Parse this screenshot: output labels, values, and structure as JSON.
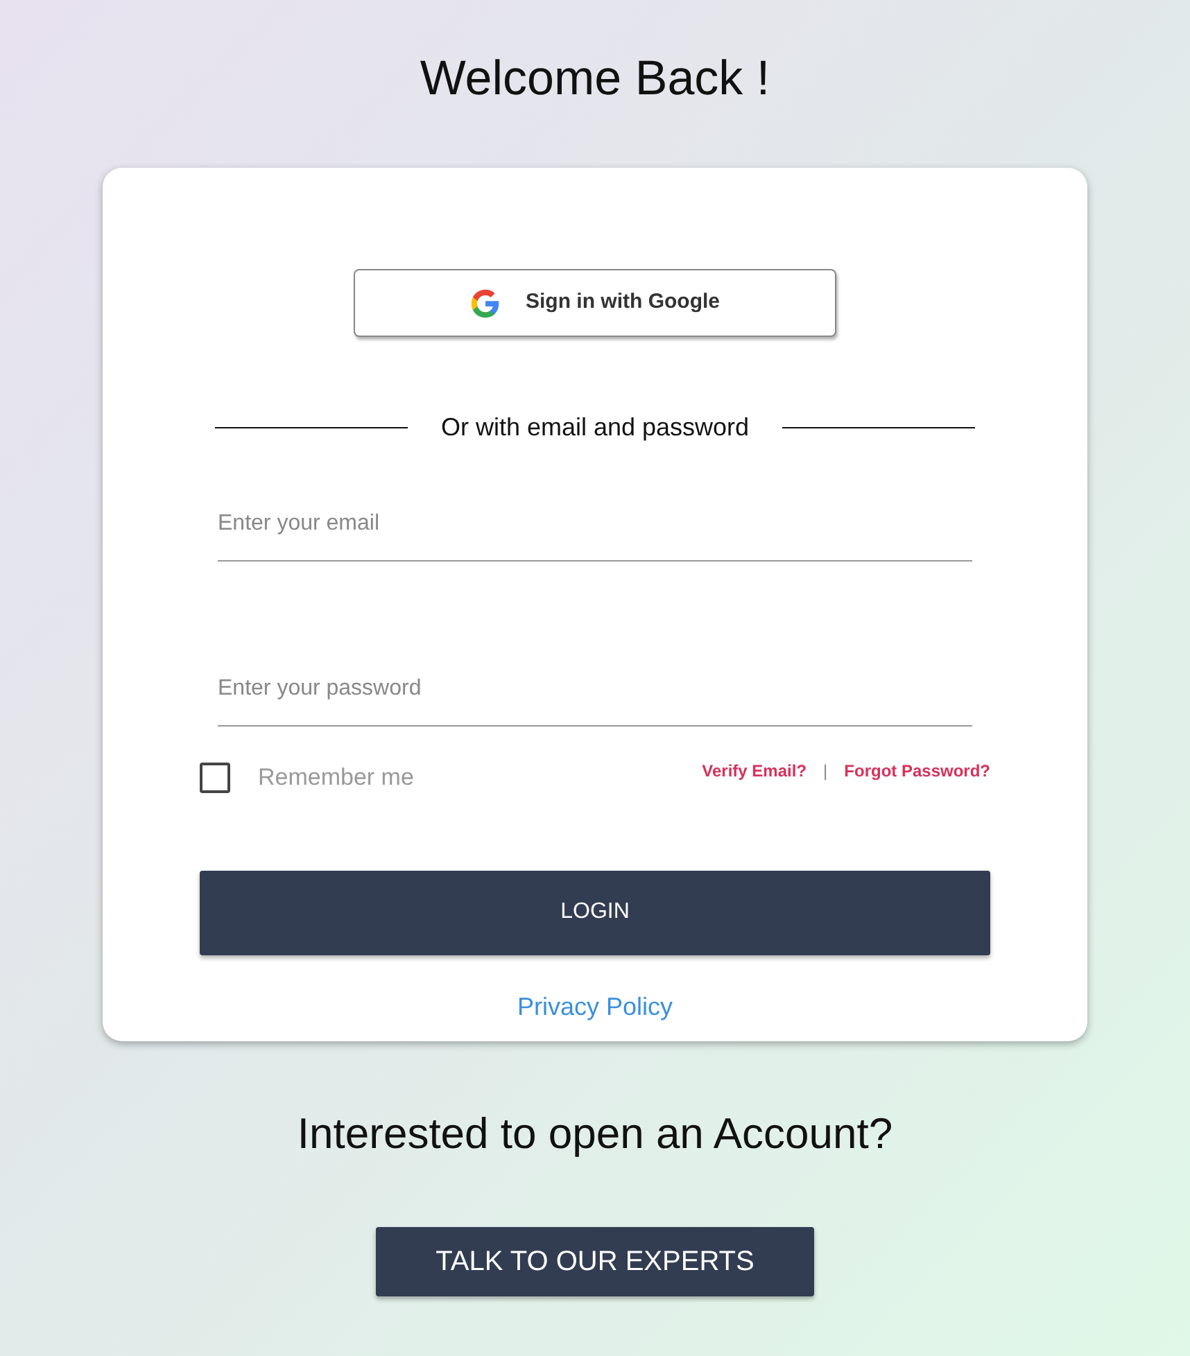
{
  "title": "Welcome Back !",
  "login_card": {
    "google_button": "Sign in with Google",
    "divider_text": "Or with email and password",
    "email": {
      "placeholder": "Enter your email"
    },
    "password": {
      "placeholder": "Enter your password"
    },
    "remember": {
      "label": "Remember me",
      "checked": false
    },
    "links": [
      "Verify Email?",
      "Forgot Password?"
    ],
    "link_separator": "|",
    "login_button": "LOGIN",
    "privacy_link": "Privacy Policy"
  },
  "signup_prompt": "Interested to open an Account?",
  "experts_button": "TALK TO OUR EXPERTS"
}
